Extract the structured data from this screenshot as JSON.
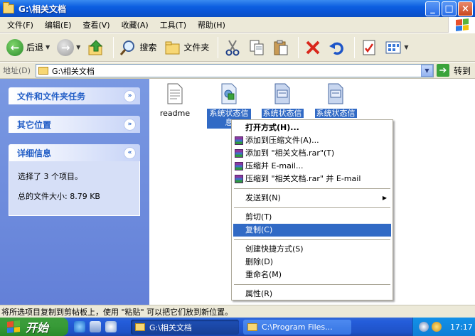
{
  "window": {
    "title": "G:\\相关文档",
    "minimize": "_",
    "maximize": "□",
    "close": "×"
  },
  "menu": [
    "文件(F)",
    "编辑(E)",
    "查看(V)",
    "收藏(A)",
    "工具(T)",
    "帮助(H)"
  ],
  "toolbar": {
    "back": "后退",
    "search": "搜索",
    "folders": "文件夹"
  },
  "address": {
    "label": "地址(D)",
    "value": "G:\\相关文档",
    "go": "转到"
  },
  "left_panels": [
    {
      "title": "文件和文件夹任务",
      "chevron": "»"
    },
    {
      "title": "其它位置",
      "chevron": "»"
    },
    {
      "title": "详细信息",
      "chevron": "«",
      "lines": [
        "选择了 3 个项目。",
        "总的文件大小: 8.79 KB"
      ]
    }
  ],
  "files": [
    {
      "name": "readme",
      "icon": "text-file-icon"
    },
    {
      "name": "系统状态信息",
      "icon": "settings-file-icon"
    },
    {
      "name": "系统状态信",
      "icon": "document-file-icon"
    },
    {
      "name": "系统状态信",
      "icon": "document-file-icon"
    }
  ],
  "context_menu": {
    "open_with": "打开方式(H)...",
    "rar1": "添加到压缩文件(A)...",
    "rar2": "添加到 \"相关文档.rar\"(T)",
    "rar3": "压缩并 E-mail...",
    "rar4": "压缩到 \"相关文档.rar\" 并 E-mail",
    "send_to": "发送到(N)",
    "cut": "剪切(T)",
    "copy": "复制(C)",
    "shortcut": "创建快捷方式(S)",
    "delete": "删除(D)",
    "rename": "重命名(M)",
    "properties": "属性(R)"
  },
  "status": "将所选项目复制到剪帖板上，使用 \"粘贴\" 可以把它们放到新位置。",
  "taskbar": {
    "start": "开始",
    "task1": "G:\\相关文档",
    "task2": "C:\\Program Files...",
    "clock": "17:17"
  },
  "colors": {
    "selection": "#316ac5",
    "titlebar": "#0a55d6",
    "start": "#379a37"
  }
}
